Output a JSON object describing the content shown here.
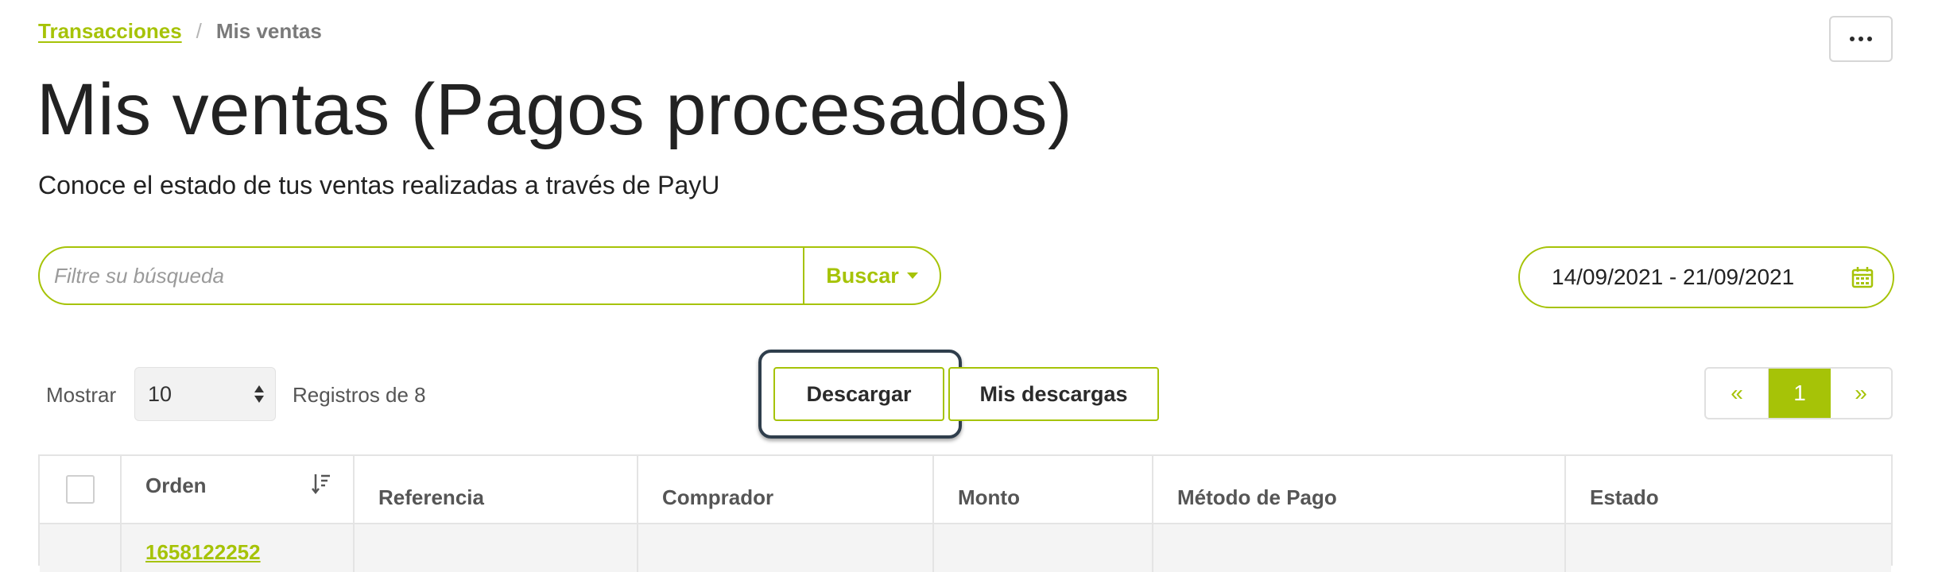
{
  "breadcrumb": {
    "parent": "Transacciones",
    "separator": "/",
    "current": "Mis ventas"
  },
  "header": {
    "title": "Mis ventas (Pagos procesados)",
    "subtitle": "Conoce el estado de tus ventas realizadas a través de PayU"
  },
  "search": {
    "placeholder": "Filtre su búsqueda",
    "value": "",
    "button_label": "Buscar"
  },
  "date_range": {
    "value": "14/09/2021 - 21/09/2021",
    "icon": "calendar-icon"
  },
  "list_controls": {
    "show_label": "Mostrar",
    "page_size": "10",
    "records_label": "Registros de 8",
    "download_label": "Descargar",
    "my_downloads_label": "Mis descargas"
  },
  "pagination": {
    "prev": "«",
    "current": "1",
    "next": "»"
  },
  "table": {
    "columns": [
      "Orden",
      "Referencia",
      "Comprador",
      "Monto",
      "Método de Pago",
      "Estado"
    ],
    "rows": [
      {
        "order": "1658122252"
      }
    ]
  },
  "colors": {
    "accent": "#a6c307",
    "text": "#2b2b2b",
    "focus_ring": "#2f3e4c",
    "border": "#e4e4e4"
  }
}
